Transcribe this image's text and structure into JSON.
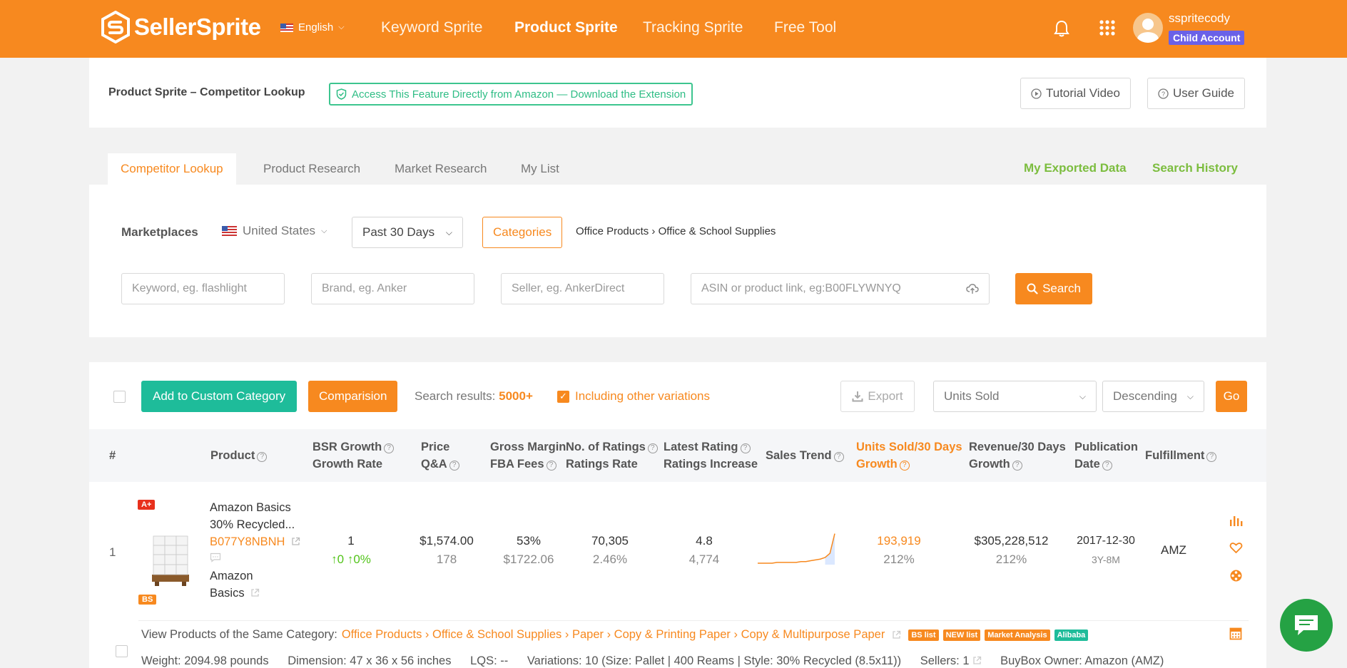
{
  "header": {
    "brand": "SellerSprite",
    "language": "English",
    "nav": [
      "Keyword Sprite",
      "Product Sprite",
      "Tracking Sprite",
      "Free Tool"
    ],
    "username": "sspritecody",
    "account_badge": "Child Account",
    "accent_color": "#f7891f"
  },
  "title_bar": {
    "title": "Product Sprite – Competitor Lookup",
    "extension_banner": "Access This Feature Directly from Amazon — Download the Extension",
    "tutorial_label": "Tutorial Video",
    "guide_label": "User Guide"
  },
  "tabs": [
    "Competitor Lookup",
    "Product Research",
    "Market Research",
    "My List"
  ],
  "right_links": {
    "exported": "My Exported Data",
    "history": "Search History"
  },
  "filters": {
    "marketplaces_label": "Marketplaces",
    "marketplace": "United States",
    "period": "Past 30 Days",
    "categories_label": "Categories",
    "category_path": "Office Products › Office & School Supplies",
    "keyword_placeholder": "Keyword, eg. flashlight",
    "brand_placeholder": "Brand, eg. Anker",
    "seller_placeholder": "Seller, eg. AnkerDirect",
    "asin_placeholder": "ASIN or product link, eg:B00FLYWNYQ",
    "search_label": "Search"
  },
  "toolbar": {
    "add_custom": "Add to Custom Category",
    "comparison": "Comparision",
    "results_prefix": "Search results:",
    "results_count": "5000+",
    "include_variations": "Including other variations",
    "export": "Export",
    "sort_field": "Units Sold",
    "sort_order": "Descending",
    "go": "Go"
  },
  "columns": {
    "index": "#",
    "product": "Product",
    "bsr_1": "BSR Growth",
    "bsr_2": "Growth Rate",
    "price_1": "Price",
    "price_2": "Q&A",
    "margin_1": "Gross Margin",
    "margin_2": "FBA Fees",
    "ratings_1": "No. of Ratings",
    "ratings_2": "Ratings Rate",
    "latest_1": "Latest Rating",
    "latest_2": "Ratings Increase",
    "trend": "Sales Trend",
    "units_1": "Units Sold/30 Days",
    "units_2": "Growth",
    "revenue_1": "Revenue/30 Days",
    "revenue_2": "Growth",
    "pub_1": "Publication",
    "pub_2": "Date",
    "fulfillment": "Fulfillment"
  },
  "rows": [
    {
      "index": "1",
      "badge_top": "A+",
      "badge_bottom": "BS",
      "title_1": "Amazon Basics",
      "title_2": "30% Recycled...",
      "asin": "B077Y8NBNH",
      "brand_1": "Amazon",
      "brand_2": "Basics",
      "bsr": "1",
      "bsr_growth": "↑0",
      "bsr_rate": "↑0%",
      "price": "$1,574.00",
      "qa": "178",
      "margin": "53%",
      "fba": "$1722.06",
      "ratings": "70,305",
      "ratings_rate": "2.46%",
      "rating": "4.8",
      "ratings_increase": "4,774",
      "trend": [
        2,
        2,
        2,
        2,
        3,
        3,
        3,
        3,
        3,
        4,
        4,
        5,
        6,
        7,
        9,
        14,
        38
      ],
      "units": "193,919",
      "units_growth": "212%",
      "revenue": "$305,228,512",
      "revenue_growth": "212%",
      "pub_date": "2017-12-30",
      "pub_age": "3Y-8M",
      "fulfillment": "AMZ",
      "category_label": "View Products of the Same Category:",
      "category_path": "Office Products › Office & School Supplies › Paper › Copy & Printing Paper › Copy & Multipurpose Paper",
      "tags": [
        {
          "text": "BS list",
          "color": "#f7891f"
        },
        {
          "text": "NEW list",
          "color": "#f7891f"
        },
        {
          "text": "Market Analysis",
          "color": "#f7891f"
        },
        {
          "text": "Alibaba",
          "color": "#1ebc9a"
        }
      ],
      "weight": "Weight: 2094.98 pounds",
      "dimension": "Dimension: 47 x 36 x 56 inches",
      "lqs": "LQS: --",
      "variations": "Variations: 10 (Size: Pallet | 400 Reams | Style: 30% Recycled (8.5x11))",
      "sellers": "Sellers: 1",
      "buybox": "BuyBox Owner:  Amazon  (AMZ)"
    }
  ]
}
